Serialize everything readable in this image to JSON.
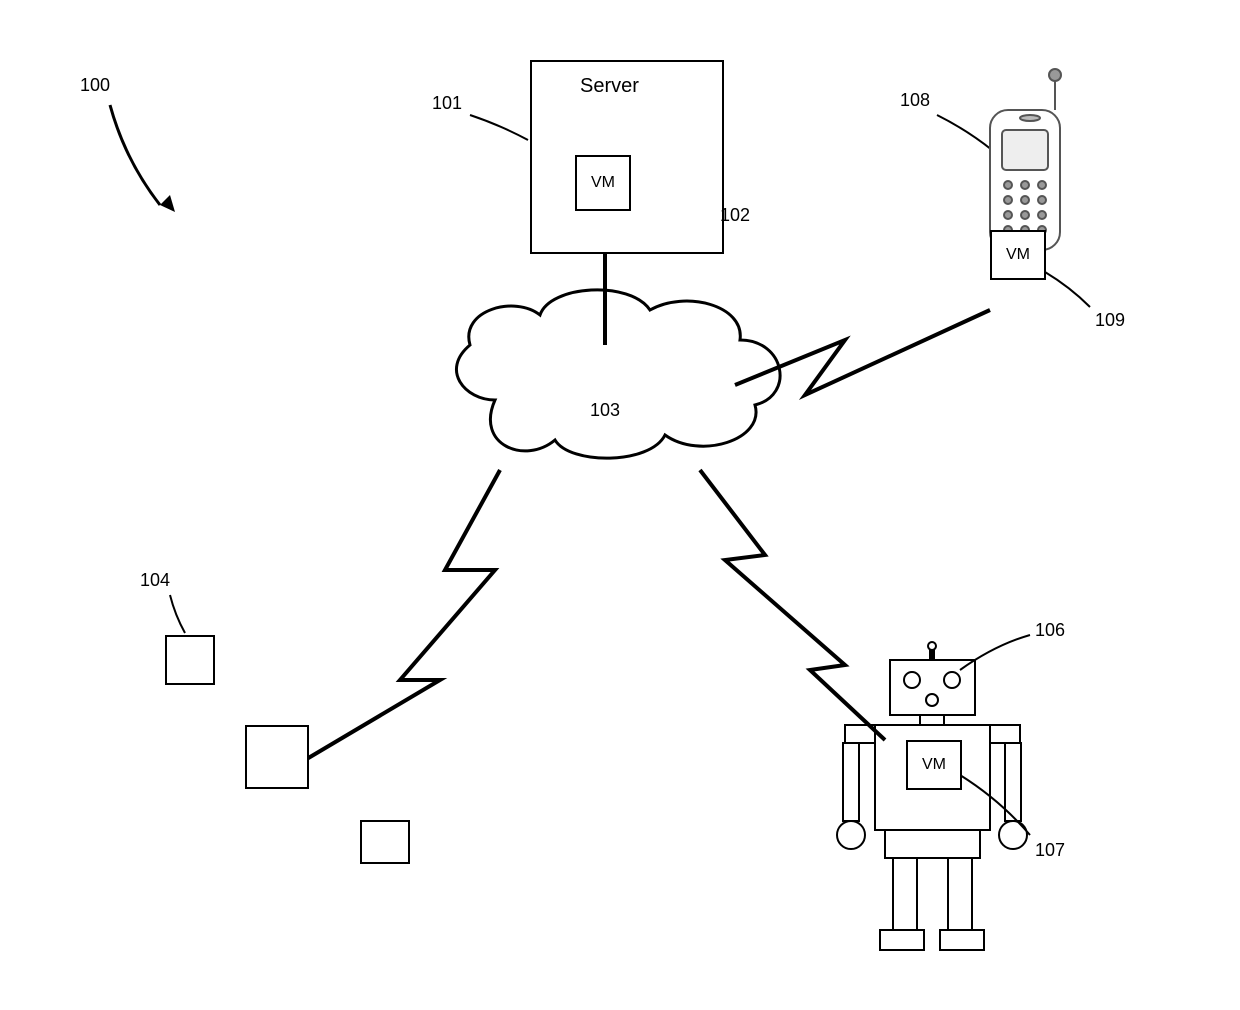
{
  "figure_ref": {
    "100": "100",
    "101": "101",
    "102": "102",
    "103": "103",
    "104": "104",
    "106": "106",
    "107": "107",
    "108": "108",
    "109": "109"
  },
  "text": {
    "server": "Server",
    "vm": "VM"
  }
}
